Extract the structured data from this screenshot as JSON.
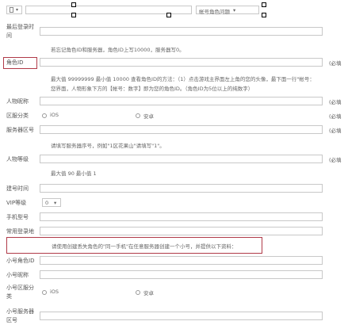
{
  "top": {
    "role_dropdown_label": "帐号角色问题",
    "role_dropdown_arrow": "▾"
  },
  "fields": {
    "last_login_label": "最后登录时间",
    "forgot_hint": "若忘记角色ID和服务器，角色ID上写10000，服务器写0。",
    "role_id_label": "角色ID",
    "role_id_required": "(必填",
    "role_id_hint_line1": "最大值 99999999  最小值 10000  查看角色ID的方法：（1）点击游戏主界面左上角的您的头像，最下面一行\"帐号：",
    "role_id_hint_line2": "您界面，人物形象下方的【帐号：数字】即为您的角色ID。（角色ID为5位以上的纯数字）",
    "nickname_label": "人物昵称",
    "nickname_required": "(必填",
    "zone_label": "区服分类",
    "zone_option_ios": "iOS",
    "zone_option_android": "安卓",
    "zone_required": "(必填",
    "server_label": "服务器区号",
    "server_required": "(必填",
    "server_hint": "请填写服务器序号，例如\"1区花果山\"请填写\"1\"。",
    "level_label": "人物等级",
    "level_required": "(必填",
    "level_hint": "最大值 90  最小值 1",
    "create_time_label": "建号时间",
    "vip_label": "VIP等级",
    "vip_value": "0",
    "vip_arrow": "▾",
    "phone_label": "手机型号",
    "common_login_label": "常用登录地",
    "notice_text": "请使用创建丢失角色的\"同一手机\"在任意服务器创建一个小号，并提供以下资料：",
    "alt_role_id_label": "小号角色ID",
    "alt_nickname_label": "小号昵称",
    "alt_zone_label_1": "小号区服分",
    "alt_zone_label_2": "类",
    "alt_zone_option_ios": "iOS",
    "alt_zone_option_android": "安卓",
    "alt_server_label": "小号服务器",
    "alt_server_label_2": "区号"
  },
  "colors": {
    "highlight_red": "#b03a48",
    "input_border": "#c8c8c8"
  }
}
